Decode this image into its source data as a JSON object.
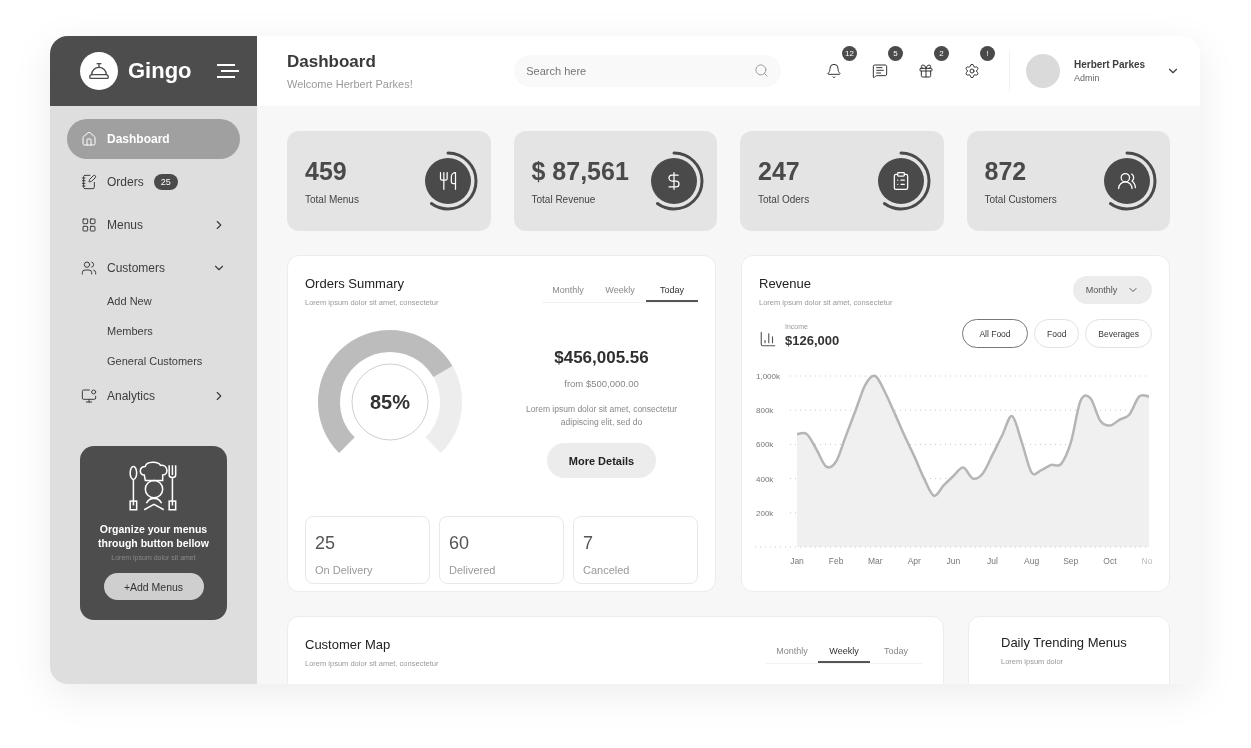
{
  "brand": {
    "name": "Gingo"
  },
  "sidebar": {
    "items": [
      {
        "label": "Dashboard",
        "selected": true
      },
      {
        "label": "Orders",
        "selected": false,
        "badge": "25"
      },
      {
        "label": "Menus",
        "selected": false,
        "expanded": false
      },
      {
        "label": "Customers",
        "selected": false,
        "expanded": true,
        "children": [
          {
            "label": "Add New"
          },
          {
            "label": "Members"
          },
          {
            "label": "General Customers"
          }
        ]
      },
      {
        "label": "Analytics",
        "selected": false,
        "expanded": false
      }
    ],
    "promo": {
      "title": "Organize your menus through button bellow",
      "text": "Lorem ipsum dolor sit amet",
      "button": "+Add Menus"
    }
  },
  "header": {
    "title": "Dashboard",
    "subtitle": "Welcome Herbert Parkes!",
    "search": {
      "placeholder": "Search here"
    },
    "notifications": [
      {
        "badge": "12"
      },
      {
        "badge": "5"
      },
      {
        "badge": "2"
      },
      {
        "badge": "!"
      }
    ],
    "user": {
      "name": "Herbert Parkes",
      "role": "Admin"
    }
  },
  "stats": [
    {
      "value": "459",
      "label": "Total Menus"
    },
    {
      "value": "$ 87,561",
      "label": "Total Revenue"
    },
    {
      "value": "247",
      "label": "Total Oders"
    },
    {
      "value": "872",
      "label": "Total Customers"
    }
  ],
  "orders_summary": {
    "title": "Orders Summary",
    "subtitle": "Lorem ipsum dolor sit amet, consectetur",
    "tabs": [
      {
        "label": "Monthly",
        "selected": false
      },
      {
        "label": "Weekly",
        "selected": false
      },
      {
        "label": "Today",
        "selected": true
      }
    ],
    "gauge": {
      "reading": "85%"
    },
    "amount": "$456,005.56",
    "from": "from $500,000.00",
    "description": "Lorem ipsum dolor sit amet, consectetur adipiscing elit, sed do",
    "button": "More Details",
    "counts": [
      {
        "value": "25",
        "label": "On Delivery"
      },
      {
        "value": "60",
        "label": "Delivered"
      },
      {
        "value": "7",
        "label": "Canceled"
      }
    ]
  },
  "revenue": {
    "title": "Revenue",
    "subtitle": "Lorem ipsum dolor sit amet, consectetur",
    "period": "Monthly",
    "income_label": "Income",
    "income": "$126,000",
    "filters": [
      {
        "label": "All Food",
        "selected": true
      },
      {
        "label": "Food",
        "selected": false
      },
      {
        "label": "Beverages",
        "selected": false
      }
    ],
    "chart_data": {
      "type": "area",
      "categories": [
        "Jan",
        null,
        null,
        null,
        "Feb",
        null,
        null,
        null,
        "Mar",
        null,
        null,
        null,
        "Apr",
        null,
        null,
        null,
        "Jun",
        null,
        null,
        null,
        "Jul",
        null,
        null,
        null,
        "Aug",
        null,
        null,
        null,
        "Sep",
        null,
        null,
        null,
        "Oct",
        null,
        null,
        null,
        "No"
      ],
      "series": [
        {
          "color": "#b5b5b5",
          "values": [
            660,
            660,
            570,
            470,
            500,
            650,
            800,
            950,
            1000,
            905,
            780,
            650,
            530,
            400,
            300,
            360,
            415,
            465,
            400,
            430,
            540,
            655,
            765,
            610,
            435,
            450,
            480,
            485,
            610,
            855,
            870,
            740,
            710,
            745,
            775,
            880,
            880
          ]
        }
      ],
      "ylim": [
        0,
        1000
      ],
      "grid": true,
      "yticks": [
        {
          "value": 200,
          "label": "200k"
        },
        {
          "value": 400,
          "label": "400k"
        },
        {
          "value": 600,
          "label": "600k"
        },
        {
          "value": 800,
          "label": "800k"
        },
        {
          "value": 1000,
          "label": "1,000k"
        }
      ]
    }
  },
  "customer_map": {
    "title": "Customer Map",
    "subtitle": "Lorem ipsum dolor sit amet, consectetur",
    "tabs": [
      {
        "label": "Monthly",
        "selected": false
      },
      {
        "label": "Weekly",
        "selected": true
      },
      {
        "label": "Today",
        "selected": false
      }
    ]
  },
  "trending": {
    "title": "Daily Trending Menus",
    "subtitle": "Lorem ipsum dolor"
  }
}
